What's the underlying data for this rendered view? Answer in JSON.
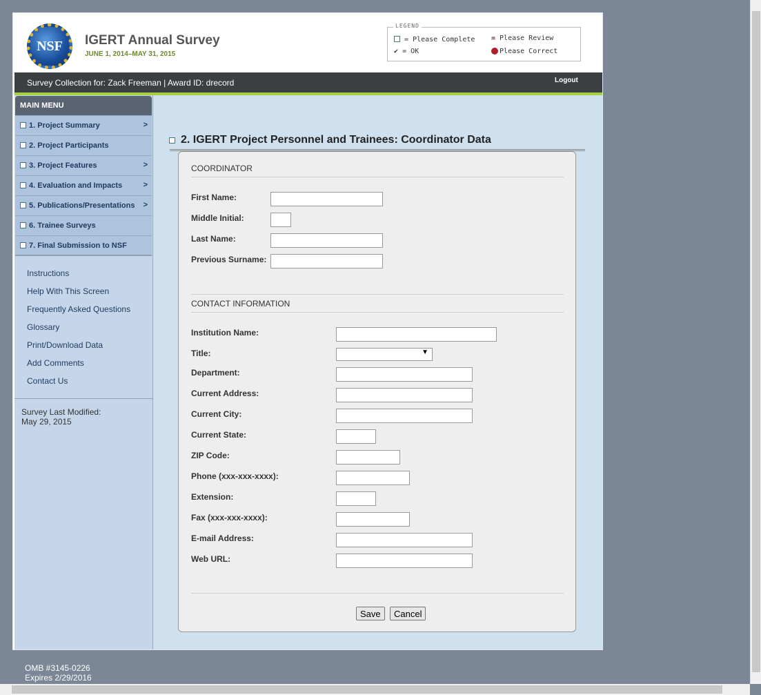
{
  "header": {
    "logo_text": "NSF",
    "title": "IGERT Annual Survey",
    "dates": "JUNE 1, 2014–MAY 31, 2015"
  },
  "legend": {
    "title": "LEGEND",
    "complete": "= Please Complete",
    "review": "= Please Review",
    "ok": "= OK",
    "correct": "= Please Correct"
  },
  "bar": {
    "collection": "Survey Collection for: Zack Freeman | Award ID: drecord",
    "logout": "Logout"
  },
  "menu": {
    "title": "MAIN MENU",
    "items": [
      {
        "label": "1. Project Summary",
        "chev": ">"
      },
      {
        "label": "2. Project Participants"
      },
      {
        "label": "3. Project Features",
        "chev": ">"
      },
      {
        "label": "4. Evaluation and Impacts",
        "chev": ">"
      },
      {
        "label": "5. Publications/Presentations",
        "chev": ">"
      },
      {
        "label": "6. Trainee Surveys"
      },
      {
        "label": "7. Final Submission to NSF"
      }
    ]
  },
  "links": [
    "Instructions",
    "Help With This Screen",
    "Frequently Asked Questions",
    "Glossary",
    "Print/Download Data",
    "Add Comments",
    "Contact Us"
  ],
  "modified": {
    "label": "Survey Last Modified:",
    "date": "May 29, 2015"
  },
  "page_title": "2. IGERT Project Personnel and Trainees: Coordinator Data",
  "form": {
    "coordinator_title": "COORDINATOR",
    "coordinator_fields": [
      "First Name:",
      "Middle Initial:",
      "Last Name:",
      "Previous Surname:"
    ],
    "contact_title": "CONTACT INFORMATION",
    "contact_fields": [
      "Institution Name:",
      "Title:",
      "Department:",
      "Current Address:",
      "Current City:",
      "Current State:",
      "ZIP Code:",
      "Phone (xxx-xxx-xxxx):",
      "Extension:",
      "Fax (xxx-xxx-xxxx):",
      "E-mail Address:",
      "Web URL:"
    ],
    "select_arrow": "▼",
    "save": "Save",
    "cancel": "Cancel"
  },
  "footer": {
    "omb": "OMB #3145-0226",
    "expires": "Expires 2/29/2016"
  }
}
